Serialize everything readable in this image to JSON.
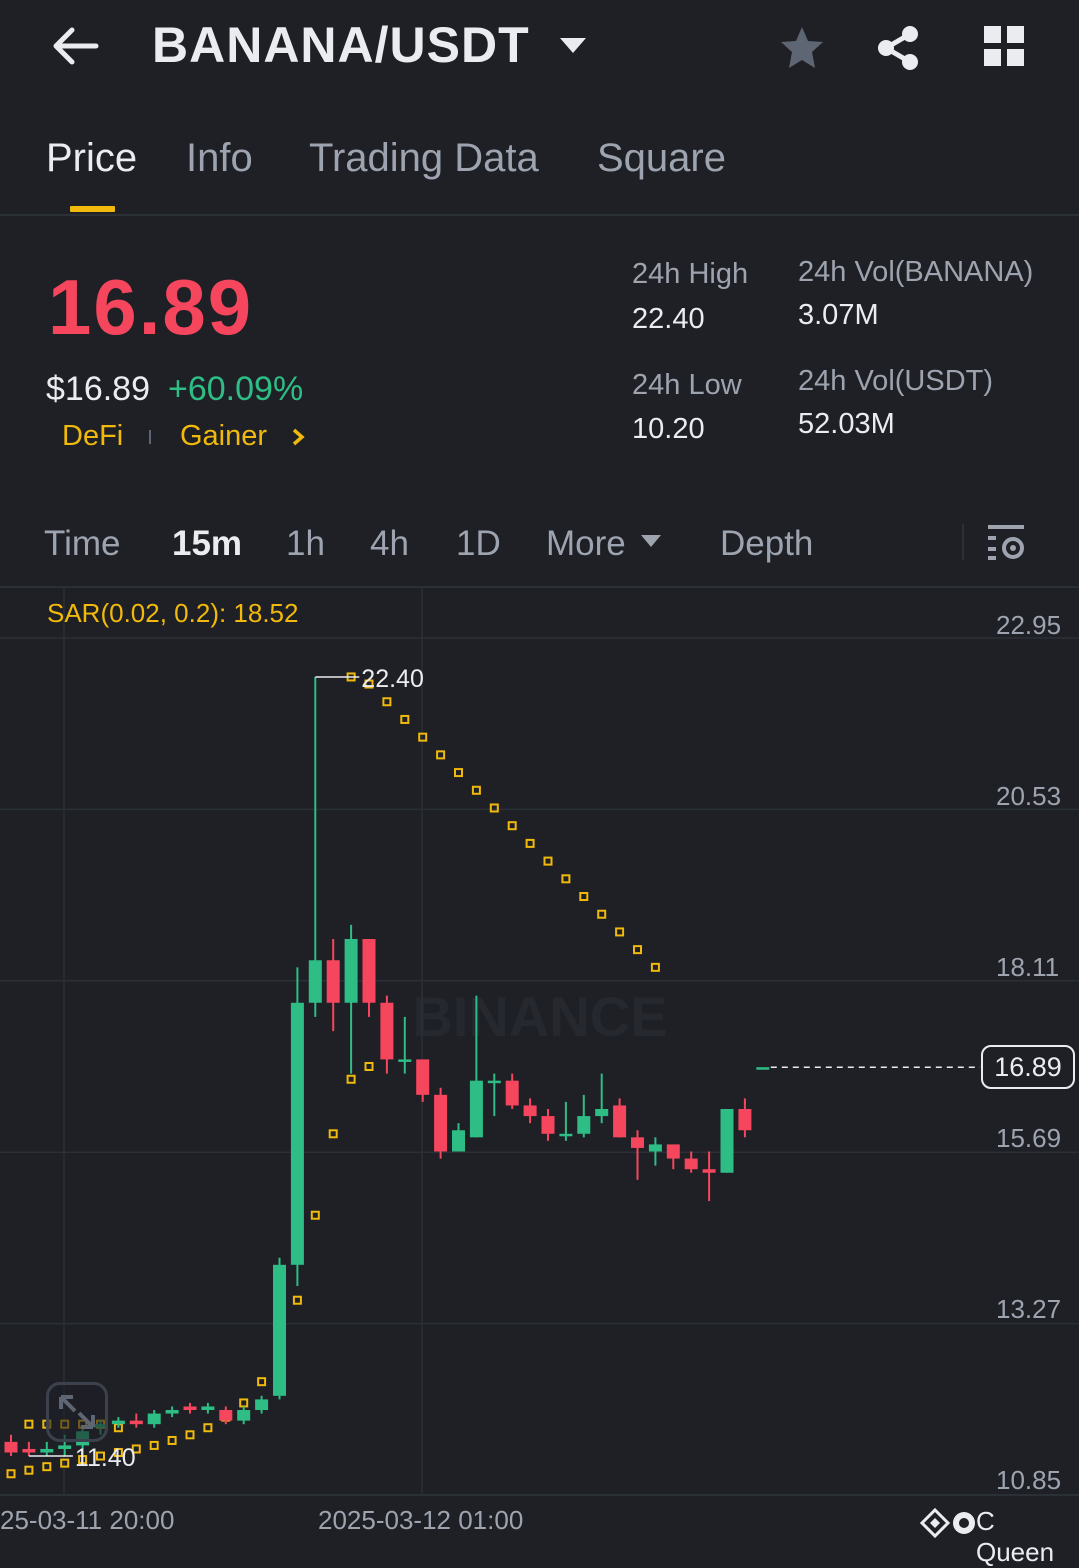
{
  "header": {
    "pair": "BANANA/USDT",
    "icons": [
      "back-arrow-icon",
      "caret-down-icon",
      "star-icon",
      "share-icon",
      "grid-icon"
    ]
  },
  "tabs": [
    {
      "label": "Price",
      "active": true
    },
    {
      "label": "Info",
      "active": false
    },
    {
      "label": "Trading Data",
      "active": false
    },
    {
      "label": "Square",
      "active": false
    }
  ],
  "ticker": {
    "last_price": "16.89",
    "usd_price": "$16.89",
    "change_pct": "+60.09%",
    "tags": [
      "DeFi",
      "Gainer"
    ],
    "high_label": "24h High",
    "high": "22.40",
    "low_label": "24h Low",
    "low": "10.20",
    "vol_base_label": "24h Vol(BANANA)",
    "vol_base": "3.07M",
    "vol_quote_label": "24h Vol(USDT)",
    "vol_quote": "52.03M"
  },
  "timeframes": [
    {
      "label": "Time",
      "active": false
    },
    {
      "label": "15m",
      "active": true
    },
    {
      "label": "1h",
      "active": false
    },
    {
      "label": "4h",
      "active": false
    },
    {
      "label": "1D",
      "active": false
    },
    {
      "label": "More",
      "active": false
    },
    {
      "label": "Depth",
      "active": false
    }
  ],
  "colors": {
    "up": "#2ebd85",
    "down": "#f6465d",
    "accent": "#f0b90b",
    "bg": "#1e2026"
  },
  "chart_data": {
    "type": "candlestick",
    "indicator": "SAR(0.02, 0.2): 18.52",
    "current_price": "16.89",
    "high_marker": "22.40",
    "low_marker": "11.40",
    "watermark": "BINANCE",
    "y_ticks": [
      "22.95",
      "20.53",
      "18.11",
      "15.69",
      "13.27",
      "10.85"
    ],
    "ylim": [
      10.85,
      22.95
    ],
    "x_ticks": [
      "25-03-11 20:00",
      "2025-03-12 01:00"
    ],
    "candles": [
      {
        "o": 11.6,
        "h": 11.7,
        "l": 11.4,
        "c": 11.45
      },
      {
        "o": 11.5,
        "h": 11.6,
        "l": 11.4,
        "c": 11.45
      },
      {
        "o": 11.45,
        "h": 11.6,
        "l": 11.4,
        "c": 11.5
      },
      {
        "o": 11.5,
        "h": 11.7,
        "l": 11.4,
        "c": 11.55
      },
      {
        "o": 11.55,
        "h": 11.8,
        "l": 11.5,
        "c": 11.75
      },
      {
        "o": 11.8,
        "h": 11.9,
        "l": 11.7,
        "c": 11.85
      },
      {
        "o": 11.85,
        "h": 11.95,
        "l": 11.8,
        "c": 11.9
      },
      {
        "o": 11.9,
        "h": 12.0,
        "l": 11.8,
        "c": 11.85
      },
      {
        "o": 11.85,
        "h": 12.05,
        "l": 11.8,
        "c": 12.0
      },
      {
        "o": 12.0,
        "h": 12.1,
        "l": 11.95,
        "c": 12.05
      },
      {
        "o": 12.1,
        "h": 12.15,
        "l": 12.0,
        "c": 12.05
      },
      {
        "o": 12.05,
        "h": 12.15,
        "l": 12.0,
        "c": 12.1
      },
      {
        "o": 12.05,
        "h": 12.1,
        "l": 11.85,
        "c": 11.9
      },
      {
        "o": 11.9,
        "h": 12.1,
        "l": 11.85,
        "c": 12.05
      },
      {
        "o": 12.05,
        "h": 12.25,
        "l": 12.0,
        "c": 12.2
      },
      {
        "o": 12.25,
        "h": 14.2,
        "l": 12.2,
        "c": 14.1
      },
      {
        "o": 14.1,
        "h": 18.3,
        "l": 13.8,
        "c": 17.8
      },
      {
        "o": 17.8,
        "h": 22.4,
        "l": 17.6,
        "c": 18.4
      },
      {
        "o": 18.4,
        "h": 18.7,
        "l": 17.4,
        "c": 17.8
      },
      {
        "o": 17.8,
        "h": 18.9,
        "l": 16.8,
        "c": 18.7
      },
      {
        "o": 18.7,
        "h": 18.7,
        "l": 17.6,
        "c": 17.8
      },
      {
        "o": 17.8,
        "h": 17.9,
        "l": 16.8,
        "c": 17.0
      },
      {
        "o": 17.0,
        "h": 17.6,
        "l": 16.8,
        "c": 17.0
      },
      {
        "o": 17.0,
        "h": 17.0,
        "l": 16.4,
        "c": 16.5
      },
      {
        "o": 16.5,
        "h": 16.6,
        "l": 15.6,
        "c": 15.7
      },
      {
        "o": 15.7,
        "h": 16.1,
        "l": 15.7,
        "c": 16.0
      },
      {
        "o": 15.9,
        "h": 17.9,
        "l": 15.9,
        "c": 16.7
      },
      {
        "o": 16.7,
        "h": 16.8,
        "l": 16.2,
        "c": 16.7
      },
      {
        "o": 16.7,
        "h": 16.8,
        "l": 16.3,
        "c": 16.35
      },
      {
        "o": 16.35,
        "h": 16.45,
        "l": 16.1,
        "c": 16.2
      },
      {
        "o": 16.2,
        "h": 16.3,
        "l": 15.85,
        "c": 15.95
      },
      {
        "o": 15.95,
        "h": 16.4,
        "l": 15.85,
        "c": 15.95
      },
      {
        "o": 15.95,
        "h": 16.5,
        "l": 15.9,
        "c": 16.2
      },
      {
        "o": 16.2,
        "h": 16.8,
        "l": 16.1,
        "c": 16.3
      },
      {
        "o": 16.35,
        "h": 16.45,
        "l": 15.9,
        "c": 15.9
      },
      {
        "o": 15.9,
        "h": 16.0,
        "l": 15.3,
        "c": 15.75
      },
      {
        "o": 15.7,
        "h": 15.9,
        "l": 15.5,
        "c": 15.8
      },
      {
        "o": 15.8,
        "h": 15.8,
        "l": 15.45,
        "c": 15.6
      },
      {
        "o": 15.6,
        "h": 15.7,
        "l": 15.4,
        "c": 15.45
      },
      {
        "o": 15.45,
        "h": 15.7,
        "l": 15.0,
        "c": 15.4
      },
      {
        "o": 15.4,
        "h": 16.3,
        "l": 15.4,
        "c": 16.3
      },
      {
        "o": 16.3,
        "h": 16.45,
        "l": 15.9,
        "c": 16.0
      },
      {
        "o": 16.89,
        "h": 16.89,
        "l": 16.89,
        "c": 16.89
      }
    ],
    "sar_below": [
      11.15,
      11.2,
      11.25,
      11.3,
      11.35,
      11.4,
      11.45,
      11.5,
      11.55,
      11.62,
      11.7,
      11.8,
      11.95,
      12.15,
      12.45,
      12.9,
      13.6,
      14.8,
      15.95,
      16.72,
      16.9
    ],
    "sar_above": [
      11.85,
      11.85,
      11.85,
      11.85,
      11.85,
      11.8,
      22.4,
      22.3,
      22.05,
      21.8,
      21.55,
      21.3,
      21.05,
      20.8,
      20.55,
      20.3,
      20.05,
      19.8,
      19.55,
      19.3,
      19.05,
      18.8,
      18.55,
      18.3
    ],
    "watermark_user": "C Queen"
  }
}
